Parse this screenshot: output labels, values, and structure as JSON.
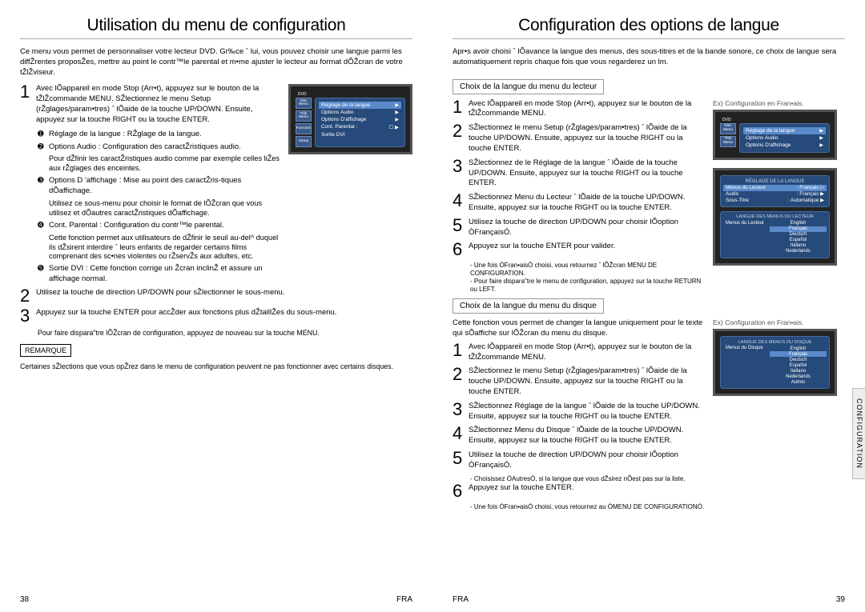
{
  "left": {
    "title": "Utilisation du menu de configuration",
    "intro": "Ce menu vous permet de personnaliser votre lecteur DVD. Gr‰ce ˆ lui, vous pouvez choisir une langue parmi les diffŽrentes proposŽes, mettre au point le contr™le parental et m•me ajuster le lecteur au format dÕŽcran de votre tŽlŽviseur.",
    "step1": "Avec lÕappareil en mode Stop (Arr•t), appuyez sur le bouton de la tŽlŽcommande MENU. SŽlectionnez le menu Setup (rŽglages/param•tres) ˆ lÕaide de la touche UP/DOWN. Ensuite, appuyez sur la touche RIGHT ou la touche ENTER.",
    "b1": "Réglage de la langue : RŽglage de la langue.",
    "b2": "Options Audio : Configuration des caractŽristiques audio.",
    "b2sub": "Pour dŽfinir les caractŽristiques audio comme par exemple celles liŽes aux rŽglages des enceintes.",
    "b3": "Options D 'affichage : Mise au point des caractŽris-tiques dÕaffichage.",
    "b3sub": "Utilisez ce sous-menu pour choisir le format de lÕŽcran que vous utilisez et dÕautres caractŽristiques dÕaffichage.",
    "b4": "Cont. Parental : Configuration du contr™le parental.",
    "b4sub": "Cette fonction permet aux utilisateurs de dŽfinir le seuil au-del^ duquel ils dŽsirent interdire ˆ leurs enfants de regarder certains films comprenant des sc•nes violentes ou rŽservŽs aux adultes, etc.",
    "b5": "Sortie DVI : Cette fonction corrige un Žcran inclinŽ et assure un affichage normal.",
    "step2": "Utilisez la touche de direction UP/DOWN pour sŽlectionner le sous-menu.",
    "step3": "Appuyez sur la touche ENTER pour accŽder aux fonctions plus dŽtaillŽes du sous-menu.",
    "dismiss": "Pour faire dispara\"tre lÕŽcran de configuration, appuyez de nouveau sur la touche MENU.",
    "remark_label": "REMARQUE",
    "remark_text": "Certaines sŽlections que vous opŽrez dans le menu de configuration peuvent ne pas fonctionner avec certains disques.",
    "page_num": "38",
    "fra": "FRA"
  },
  "right": {
    "title": "Configuration des options de langue",
    "intro": "Apr•s avoir choisi ˆ lÕavance la langue des menus, des sous-titres et de la bande sonore, ce choix de langue sera automatiquement repris chaque fois que vous regarderez un lm.",
    "sectA": "Choix de la langue du menu du lecteur",
    "a1": "Avec lÕappareil en mode Stop (Arr•t), appuyez sur le bouton de la tŽlŽcommande MENU.",
    "a2": "SŽlectionnez le menu Setup (rŽglages/param•tres) ˆ lÕaide de la touche UP/DOWN. Ensuite, appuyez sur la touche RIGHT ou la touche ENTER.",
    "a3": "SŽlectionnez de le Réglage de la langue  ˆ lÕaide de la touche UP/DOWN. Ensuite, appuyez sur la touche RIGHT ou la touche ENTER.",
    "a4": "SŽlectionnez Menu du Lecteur ˆ lÕaide de la touche UP/DOWN. Ensuite, appuyez sur la touche RIGHT ou la touche ENTER.",
    "a5": "Utilisez la touche de direction UP/DOWN pour choisir lÕoption ÒFrançaisÓ.",
    "a6": "Appuyez sur la touche ENTER pour valider.",
    "a6n1": "- Une fois ÒFran•aisÓ choisi, vous retournez ˆ lÕŽcran MENU DE CONFIGURATION.",
    "a6n2": "- Pour faire dispara\"tre le menu de configuration, appuyez sur la touche RETURN ou LEFT.",
    "sectB": "Choix de la langue du menu du disque",
    "bintro": "Cette fonction vous permet de changer la langue uniquement pour le texte qui sÕaffiche sur lÕŽcran du menu du disque.",
    "b1": "Avec lÕappareil en mode Stop (Arr•t), appuyez sur le bouton de la tŽlŽcommande MENU.",
    "b2": "SŽlectionnez le menu Setup (rŽglages/param•tres) ˆ lÕaide de la touche UP/DOWN. Ensuite, appuyez sur la touche RIGHT ou la touche ENTER.",
    "b3": "SŽlectionnez Réglage de la langue  ˆ lÕaide de la touche UP/DOWN. Ensuite, appuyez sur la touche RIGHT ou la touche ENTER.",
    "b4": "SŽlectionnez Menu du Disque ˆ lÕaide de la touche UP/DOWN. Ensuite, appuyez sur la touche RIGHT ou la touche ENTER.",
    "b5": "Utilisez la touche de direction UP/DOWN pour choisir lÕoption ÒFrançaisÓ.",
    "b5n": "- Choisissez ÒAutresÓ, si la langue que vous dŽsirez nÕest pas sur la liste.",
    "b6": "Appuyez sur la touche ENTER.",
    "b6n": "- Une fois ÒFran•aisÓ choisi, vous retournez au ÒMENU DE CONFIGURATIONÓ.",
    "ex_label": "Ex) Configuration en Fran•ais.",
    "page_num": "39",
    "fra": "FRA",
    "vtab": "CONFIGURATION"
  },
  "tv1": {
    "dvd": "DVD",
    "r1": "Réglage de la langue",
    "r2": "Options Audio",
    "r3": "Options D'affichage",
    "r4": "Cont. Parental :",
    "r5": "Sortie DVI",
    "i1": "Disc Menu",
    "i2": "Title Menu",
    "i3": "Function",
    "i4": "Setup"
  },
  "tv2": {
    "title": "RÉGLAGE DE LA LANGUE",
    "r1l": "Menus du Lecteur",
    "r1r": ": Français",
    "r2l": "Audio",
    "r2r": ": Français",
    "r3l": "Sous-Titre",
    "r3r": ": Automatique"
  },
  "tv3": {
    "title": "LANGUE DES MENUS DU LECTEUR",
    "col": "Menus du Lecteur",
    "langs": [
      "English",
      "Français",
      "Deutsch",
      "Español",
      "Italiano",
      "Nederlands"
    ]
  },
  "tv4": {
    "title": "LANGUE DES MENUS DU DISQUE",
    "col": "Menus du Disque",
    "langs": [
      "English",
      "Français",
      "Deutsch",
      "Español",
      "Italiano",
      "Nederlands",
      "Autres"
    ]
  }
}
